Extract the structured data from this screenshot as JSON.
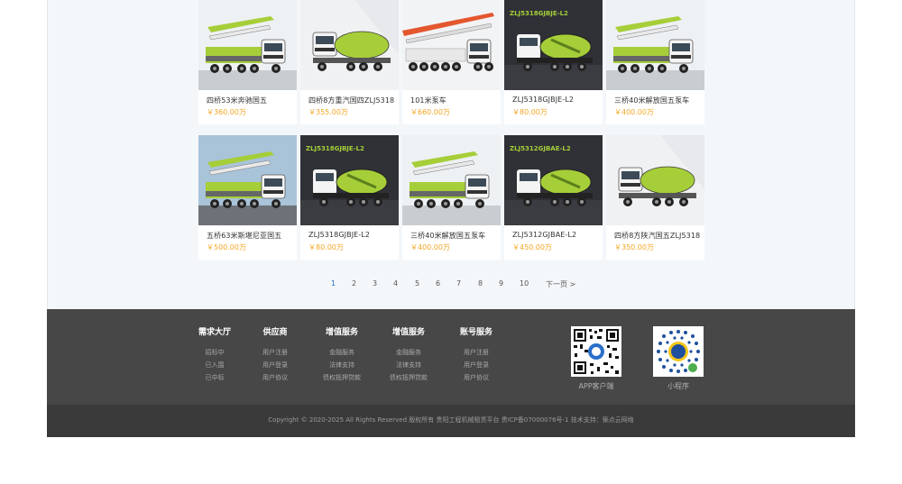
{
  "products": [
    {
      "title": "四桥53米奔驰国五",
      "price": "￥360.00万",
      "image": "pump-truck-photo",
      "banner": ""
    },
    {
      "title": "四桥8方重汽国四ZLJ5318",
      "price": "￥355.00万",
      "image": "mixer-truck-photo",
      "banner": ""
    },
    {
      "title": "101米泵车",
      "price": "￥660.00万",
      "image": "long-pump-truck-photo",
      "banner": ""
    },
    {
      "title": "ZLJ5318GJBJE-L2",
      "price": "￥80.00万",
      "image": "mixer-dark-photo",
      "banner": "ZLJ5318GJBJE-L2"
    },
    {
      "title": "三桥40米解放国五泵车",
      "price": "￥400.00万",
      "image": "pump-truck-photo",
      "banner": ""
    },
    {
      "title": "五桥63米斯堪尼亚国五",
      "price": "￥500.00万",
      "image": "pump-truck-road-photo",
      "banner": ""
    },
    {
      "title": "ZLJ5318GJBJE-L2",
      "price": "￥80.00万",
      "image": "mixer-dark-photo",
      "banner": "ZLJ5318GJBJE-L2"
    },
    {
      "title": "三桥40米解放国五泵车",
      "price": "￥400.00万",
      "image": "pump-truck-photo",
      "banner": ""
    },
    {
      "title": "ZLJ5312GJBAE-L2",
      "price": "￥450.00万",
      "image": "mixer-dark-photo",
      "banner": "ZLJ5312GJBAE-L2"
    },
    {
      "title": "四桥8方陕汽国五ZLJ5318",
      "price": "￥350.00万",
      "image": "mixer-truck-photo",
      "banner": ""
    }
  ],
  "pagination": {
    "pages": [
      "1",
      "2",
      "3",
      "4",
      "5",
      "6",
      "7",
      "8",
      "9",
      "10"
    ],
    "active": "1",
    "next": "下一页 >"
  },
  "footer": {
    "columns": [
      {
        "title": "需求大厅",
        "links": [
          "招标中",
          "已入围",
          "已中标"
        ]
      },
      {
        "title": "供应商",
        "links": [
          "用户注册",
          "用户登录",
          "用户协议"
        ]
      },
      {
        "title": "增值服务",
        "links": [
          "金融服务",
          "法律支持",
          "债权抵押贷款"
        ]
      },
      {
        "title": "增值服务",
        "links": [
          "金融服务",
          "法律支持",
          "债权抵押贷款"
        ]
      },
      {
        "title": "账号服务",
        "links": [
          "用户注册",
          "用户登录",
          "用户协议"
        ]
      }
    ],
    "qr_app_label": "APP客户端",
    "qr_mini_label": "小程序",
    "copyright": "Copyright © 2020-2025 All Rights Reserved 版权所有 贵阳工程机械租赁平台 贵ICP备07000076号-1     技术支持：築点云网络"
  },
  "colors": {
    "accent_green": "#a6ce39",
    "price": "#f5a623",
    "active_page": "#1a73c8",
    "footer_bg": "#474747"
  }
}
